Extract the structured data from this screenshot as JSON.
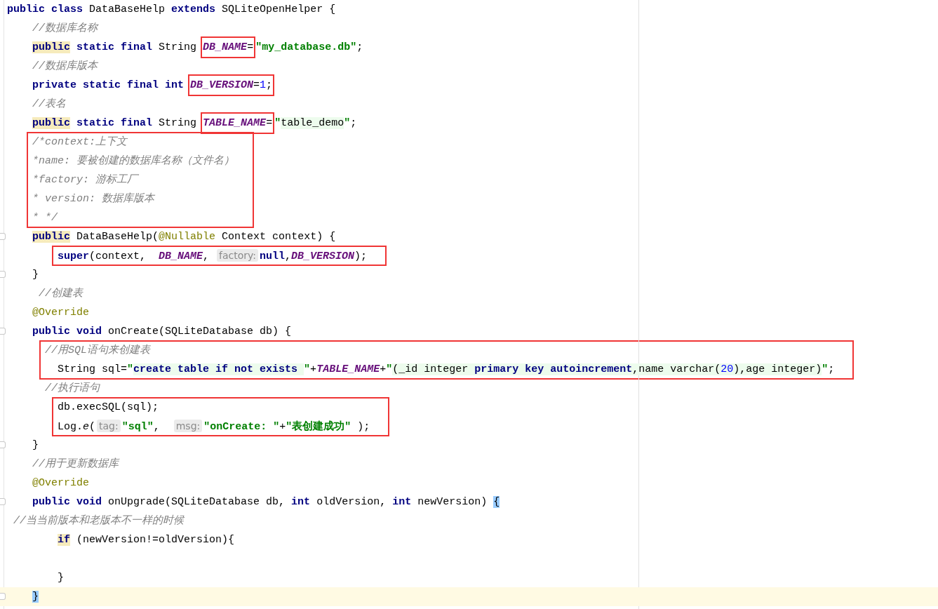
{
  "editor": {
    "lines": [
      {
        "kind": "line",
        "tokens": [
          {
            "kind": "kw",
            "text": "public class"
          },
          {
            "kind": "plain",
            "text": " DataBaseHelp "
          },
          {
            "kind": "kw",
            "text": "extends"
          },
          {
            "kind": "plain",
            "text": " SQLiteOpenHelper {"
          }
        ]
      },
      {
        "kind": "line",
        "tokens": [
          {
            "kind": "comment",
            "text": "    //数据库名称"
          }
        ]
      },
      {
        "kind": "line",
        "tokens": [
          {
            "kind": "kw",
            "text": "    public",
            "highlighted": true
          },
          {
            "kind": "kw",
            "text": " static final"
          },
          {
            "kind": "plain",
            "text": " String "
          },
          {
            "kind": "box",
            "tokens": [
              {
                "kind": "const",
                "text": "DB_NAME"
              },
              {
                "kind": "plain",
                "text": "="
              }
            ]
          },
          {
            "kind": "str",
            "text": "\"my_database.db\""
          },
          {
            "kind": "plain",
            "text": ";"
          }
        ]
      },
      {
        "kind": "line",
        "tokens": [
          {
            "kind": "comment",
            "text": "    //数据库版本"
          }
        ]
      },
      {
        "kind": "line",
        "tokens": [
          {
            "kind": "kw",
            "text": "    private static final int "
          },
          {
            "kind": "box",
            "tokens": [
              {
                "kind": "const",
                "text": "DB_VERSION"
              },
              {
                "kind": "plain",
                "text": "="
              },
              {
                "kind": "num",
                "text": "1"
              },
              {
                "kind": "plain",
                "text": ";"
              }
            ]
          }
        ]
      },
      {
        "kind": "line",
        "tokens": [
          {
            "kind": "comment",
            "text": "    //表名"
          }
        ]
      },
      {
        "kind": "line",
        "tokens": [
          {
            "kind": "kw",
            "text": "    public",
            "highlighted": true
          },
          {
            "kind": "kw",
            "text": " static final"
          },
          {
            "kind": "plain",
            "text": " String "
          },
          {
            "kind": "box",
            "tokens": [
              {
                "kind": "const",
                "text": "TABLE_NAME"
              },
              {
                "kind": "plain",
                "text": "="
              }
            ]
          },
          {
            "kind": "str",
            "text": "\""
          },
          {
            "kind": "sql",
            "text": "table_demo"
          },
          {
            "kind": "str",
            "text": "\""
          },
          {
            "kind": "plain",
            "text": ";"
          }
        ]
      },
      {
        "kind": "boxed",
        "lines": [
          {
            "kind": "line",
            "tokens": [
              {
                "kind": "comment",
                "text": "    /*context:上下文"
              }
            ]
          },
          {
            "kind": "line",
            "tokens": [
              {
                "kind": "comment",
                "text": "    *name: 要被创建的数据库名称（文件名）"
              }
            ]
          },
          {
            "kind": "line",
            "tokens": [
              {
                "kind": "comment",
                "text": "    *factory: 游标工厂"
              }
            ]
          },
          {
            "kind": "line",
            "tokens": [
              {
                "kind": "comment",
                "text": "    * version: 数据库版本"
              }
            ]
          },
          {
            "kind": "line",
            "tokens": [
              {
                "kind": "comment",
                "text": "    * */"
              }
            ]
          }
        ]
      },
      {
        "kind": "line",
        "fold": true,
        "tokens": [
          {
            "kind": "kw",
            "text": "    public",
            "highlighted": true
          },
          {
            "kind": "plain",
            "text": " DataBaseHelp("
          },
          {
            "kind": "annot",
            "text": "@Nullable"
          },
          {
            "kind": "plain",
            "text": " Context context) {"
          }
        ]
      },
      {
        "kind": "boxed",
        "lines": [
          {
            "kind": "line",
            "tokens": [
              {
                "kind": "kw",
                "text": "        super"
              },
              {
                "kind": "plain",
                "text": "(context,  "
              },
              {
                "kind": "const",
                "text": "DB_NAME"
              },
              {
                "kind": "plain",
                "text": ", "
              },
              {
                "kind": "hint",
                "text": "factory:"
              },
              {
                "kind": "kw",
                "text": "null"
              },
              {
                "kind": "plain",
                "text": ","
              },
              {
                "kind": "const",
                "text": "DB_VERSION"
              },
              {
                "kind": "plain",
                "text": ");"
              }
            ]
          }
        ]
      },
      {
        "kind": "line",
        "fold": true,
        "tokens": [
          {
            "kind": "plain",
            "text": "    }"
          }
        ]
      },
      {
        "kind": "line",
        "tokens": [
          {
            "kind": "comment",
            "text": "     //创建表"
          }
        ]
      },
      {
        "kind": "line",
        "tokens": [
          {
            "kind": "annot",
            "text": "    @Override"
          }
        ]
      },
      {
        "kind": "line",
        "fold": true,
        "tokens": [
          {
            "kind": "kw",
            "text": "    public void"
          },
          {
            "kind": "plain",
            "text": " onCreate(SQLiteDatabase db) {"
          }
        ]
      },
      {
        "kind": "boxed",
        "lines": [
          {
            "kind": "line",
            "tokens": [
              {
                "kind": "comment",
                "text": "      //用SQL语句来创建表"
              }
            ]
          },
          {
            "kind": "line",
            "tokens": [
              {
                "kind": "plain",
                "text": "        String sql="
              },
              {
                "kind": "str",
                "text": "\""
              },
              {
                "kind": "sqlkw",
                "text": "create table if not exists "
              },
              {
                "kind": "str",
                "text": "\""
              },
              {
                "kind": "plain",
                "text": "+"
              },
              {
                "kind": "const",
                "text": "TABLE_NAME"
              },
              {
                "kind": "plain",
                "text": "+"
              },
              {
                "kind": "str",
                "text": "\""
              },
              {
                "kind": "sql",
                "text": "(_id integer "
              },
              {
                "kind": "sqlkw",
                "text": "primary key autoincrement"
              },
              {
                "kind": "sql",
                "text": ",name varchar("
              },
              {
                "kind": "sqlnum",
                "text": "20"
              },
              {
                "kind": "sql",
                "text": "),age integer)"
              },
              {
                "kind": "str",
                "text": "\""
              },
              {
                "kind": "plain",
                "text": ";"
              }
            ]
          }
        ]
      },
      {
        "kind": "line",
        "tokens": [
          {
            "kind": "comment",
            "text": "      //执行语句"
          }
        ]
      },
      {
        "kind": "boxed",
        "lines": [
          {
            "kind": "line",
            "tokens": [
              {
                "kind": "plain",
                "text": "        db.execSQL(sql);"
              }
            ]
          },
          {
            "kind": "line",
            "tokens": [
              {
                "kind": "plain",
                "text": "        Log."
              },
              {
                "kind": "method",
                "text": "e"
              },
              {
                "kind": "plain",
                "text": "("
              },
              {
                "kind": "hint",
                "text": "tag:"
              },
              {
                "kind": "str",
                "text": "\"sql\""
              },
              {
                "kind": "plain",
                "text": ",  "
              },
              {
                "kind": "hint",
                "text": "msg:"
              },
              {
                "kind": "str",
                "text": "\"onCreate: \""
              },
              {
                "kind": "plain",
                "text": "+"
              },
              {
                "kind": "str",
                "text": "\"表创建成功\""
              },
              {
                "kind": "plain",
                "text": " );"
              }
            ]
          }
        ]
      },
      {
        "kind": "line",
        "fold": true,
        "tokens": [
          {
            "kind": "plain",
            "text": "    }"
          }
        ]
      },
      {
        "kind": "line",
        "tokens": [
          {
            "kind": "comment",
            "text": "    //用于更新数据库"
          }
        ]
      },
      {
        "kind": "line",
        "tokens": [
          {
            "kind": "annot",
            "text": "    @Override"
          }
        ]
      },
      {
        "kind": "line",
        "fold": true,
        "tokens": [
          {
            "kind": "kw",
            "text": "    public void"
          },
          {
            "kind": "plain",
            "text": " onUpgrade(SQLiteDatabase db, "
          },
          {
            "kind": "kw",
            "text": "int"
          },
          {
            "kind": "plain",
            "text": " oldVersion, "
          },
          {
            "kind": "kw",
            "text": "int"
          },
          {
            "kind": "plain",
            "text": " newVersion) "
          },
          {
            "kind": "plain",
            "text": "{",
            "matched_brace": true
          }
        ]
      },
      {
        "kind": "line",
        "tokens": [
          {
            "kind": "comment",
            "text": " //当当前版本和老版本不一样的时候"
          }
        ]
      },
      {
        "kind": "line",
        "tokens": [
          {
            "kind": "kw",
            "text": "        if",
            "highlighted": true
          },
          {
            "kind": "plain",
            "text": " (newVersion!=oldVersion){"
          }
        ]
      },
      {
        "kind": "line"
      },
      {
        "kind": "line",
        "tokens": [
          {
            "kind": "plain",
            "text": "        }"
          }
        ]
      },
      {
        "kind": "line",
        "current": true,
        "fold": true,
        "tokens": [
          {
            "kind": "plain",
            "text": "    }",
            "matched_brace": true
          }
        ]
      }
    ]
  }
}
